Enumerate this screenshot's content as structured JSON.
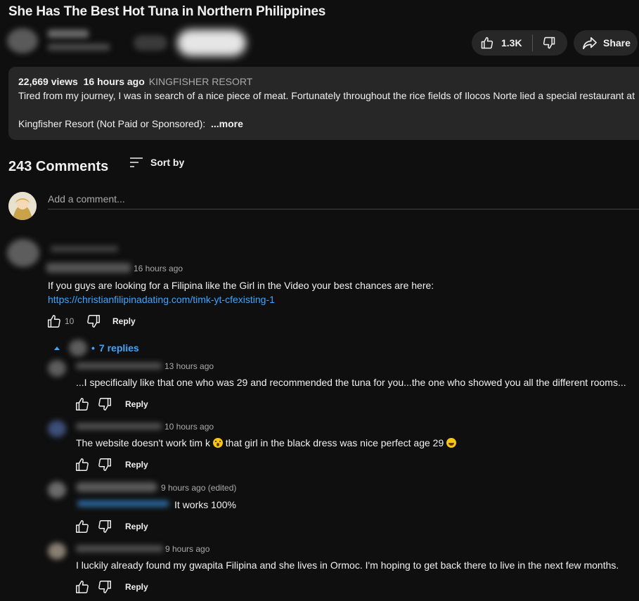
{
  "video": {
    "title": "She Has The Best Hot Tuna in Northern Philippines",
    "like_count": "1.3K",
    "share_label": "Share"
  },
  "description": {
    "views": "22,669 views",
    "age": "16 hours ago",
    "location": "KINGFISHER RESORT",
    "text": "Tired from my journey, I was in search of a nice piece of meat.  Fortunately throughout the rice fields of Ilocos Norte lied a special restaurant at",
    "line2": "Kingfisher Resort (Not Paid or Sponsored): ",
    "more_label": "...more"
  },
  "comments_header": {
    "count": "243 Comments",
    "sort_label": "Sort by",
    "add_placeholder": "Add a comment..."
  },
  "top_comment": {
    "time": "16 hours ago",
    "text": "If you guys are looking for a Filipina like the Girl in the Video your best chances are here:",
    "link": "https://christianfilipinadating.com/timk-yt-cfexisting-1",
    "likes": "10",
    "reply_label": "Reply",
    "replies_label": "7 replies"
  },
  "replies": [
    {
      "time": "13 hours ago",
      "text": "...I specifically like that one who was 29 and recommended the tuna for you...the one who showed you all the different rooms...",
      "reply_label": "Reply"
    },
    {
      "time": "10 hours ago",
      "text_a": "The website doesn't work tim k ",
      "text_b": "  that girl in the black dress was nice perfect age 29 ",
      "reply_label": "Reply",
      "emoji_1": "astonished-face-icon",
      "emoji_2": "laughing-face-icon"
    },
    {
      "time": "9 hours ago (edited)",
      "text": "It works 100%",
      "reply_label": "Reply"
    },
    {
      "time": "9 hours ago",
      "text": "I luckily already found my gwapita Filipina and she lives in Ormoc.  I'm hoping to get back there to live in the next few months.",
      "reply_label": "Reply"
    }
  ],
  "colors": {
    "background": "#0f0f0f",
    "surface": "#272727",
    "link": "#3ea6ff",
    "secondary_text": "#aaaaaa"
  }
}
